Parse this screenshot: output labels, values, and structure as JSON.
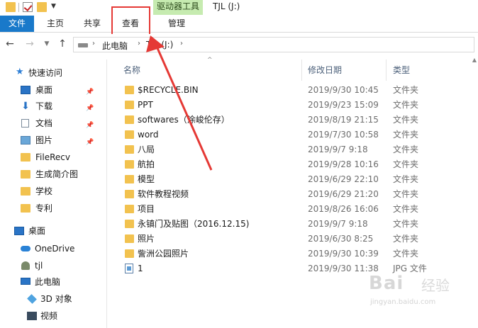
{
  "title_bar": {
    "context_tab": "驱动器工具",
    "window_title": "TJL (J:)"
  },
  "ribbon": {
    "tabs": [
      {
        "label": "文件"
      },
      {
        "label": "主页"
      },
      {
        "label": "共享"
      },
      {
        "label": "查看"
      },
      {
        "label": "管理"
      }
    ],
    "file_tab_color": "#1979ca",
    "context_tab_color": "#c6ebb0"
  },
  "address": {
    "crumbs": [
      "此电脑",
      "TJL (J:)"
    ]
  },
  "sidebar": {
    "quick_access": "快速访问",
    "items": [
      {
        "label": "桌面",
        "icon": "desktop-icon",
        "pinned": true
      },
      {
        "label": "下载",
        "icon": "download-arrow-icon",
        "pinned": true
      },
      {
        "label": "文档",
        "icon": "document-icon",
        "pinned": true
      },
      {
        "label": "图片",
        "icon": "pictures-icon",
        "pinned": true
      },
      {
        "label": "FileRecv",
        "icon": "folder-icon"
      },
      {
        "label": "生成简介图",
        "icon": "folder-icon"
      },
      {
        "label": "学校",
        "icon": "folder-icon"
      },
      {
        "label": "专利",
        "icon": "folder-icon"
      }
    ],
    "tree": [
      {
        "label": "桌面",
        "icon": "desktop-icon"
      },
      {
        "label": "OneDrive",
        "icon": "cloud-icon"
      },
      {
        "label": "tjl",
        "icon": "user-icon"
      },
      {
        "label": "此电脑",
        "icon": "computer-icon"
      },
      {
        "label": "3D 对象",
        "icon": "3d-objects-icon"
      },
      {
        "label": "视频",
        "icon": "video-icon"
      }
    ]
  },
  "file_list": {
    "columns": {
      "name": "名称",
      "date": "修改日期",
      "type": "类型"
    },
    "rows": [
      {
        "name": "$RECYCLE.BIN",
        "date": "2019/9/30 10:45",
        "type": "文件夹",
        "icon": "folder-icon"
      },
      {
        "name": "PPT",
        "date": "2019/9/23 15:09",
        "type": "文件夹",
        "icon": "folder-icon"
      },
      {
        "name": "softwares（涂峻伦存）",
        "date": "2019/8/19 21:15",
        "type": "文件夹",
        "icon": "folder-icon"
      },
      {
        "name": "word",
        "date": "2019/7/30 10:58",
        "type": "文件夹",
        "icon": "folder-icon"
      },
      {
        "name": "八局",
        "date": "2019/9/7 9:18",
        "type": "文件夹",
        "icon": "folder-icon"
      },
      {
        "name": "航拍",
        "date": "2019/9/28 10:16",
        "type": "文件夹",
        "icon": "folder-icon"
      },
      {
        "name": "模型",
        "date": "2019/6/29 22:10",
        "type": "文件夹",
        "icon": "folder-icon"
      },
      {
        "name": "软件教程视频",
        "date": "2019/6/29 21:20",
        "type": "文件夹",
        "icon": "folder-icon"
      },
      {
        "name": "项目",
        "date": "2019/8/26 16:06",
        "type": "文件夹",
        "icon": "folder-icon"
      },
      {
        "name": "永镇门及贴图（2016.12.15)",
        "date": "2019/9/7 9:18",
        "type": "文件夹",
        "icon": "folder-icon"
      },
      {
        "name": "照片",
        "date": "2019/6/30 8:25",
        "type": "文件夹",
        "icon": "folder-icon"
      },
      {
        "name": "訾洲公园照片",
        "date": "2019/9/30 10:39",
        "type": "文件夹",
        "icon": "folder-icon"
      },
      {
        "name": "1",
        "date": "2019/9/30 11:38",
        "type": "JPG 文件",
        "icon": "jpg-file-icon"
      }
    ]
  },
  "annotation": {
    "highlight_color": "#e53935"
  },
  "watermark": {
    "brand": "Bai经验",
    "url": "jingyan.baidu.com"
  }
}
